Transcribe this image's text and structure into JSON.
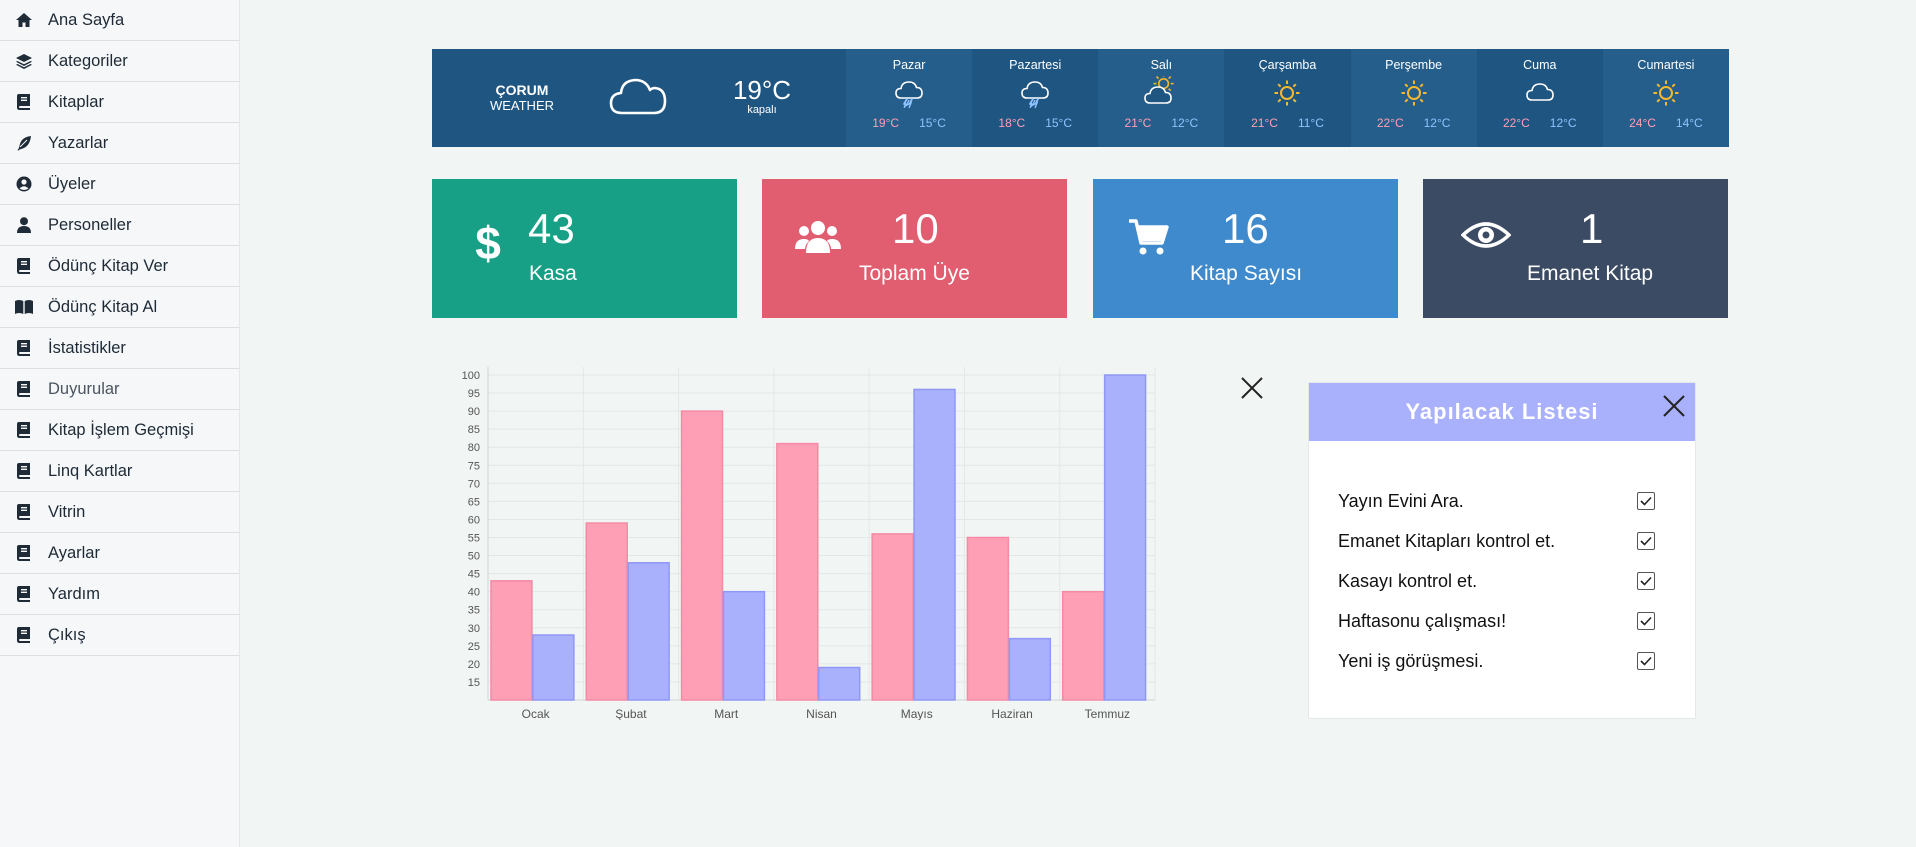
{
  "sidebar": {
    "items": [
      {
        "label": "Ana Sayfa",
        "icon": "home-icon"
      },
      {
        "label": "Kategoriler",
        "icon": "layers-icon"
      },
      {
        "label": "Kitaplar",
        "icon": "book-icon"
      },
      {
        "label": "Yazarlar",
        "icon": "feather-icon"
      },
      {
        "label": "Üyeler",
        "icon": "user-circle-icon"
      },
      {
        "label": "Personeller",
        "icon": "user-icon"
      },
      {
        "label": "Ödünç Kitap Ver",
        "icon": "book-icon"
      },
      {
        "label": "Ödünç Kitap Al",
        "icon": "open-book-icon"
      },
      {
        "label": "İstatistikler",
        "icon": "book-icon"
      },
      {
        "label": "Duyurular",
        "icon": "book-icon"
      },
      {
        "label": "Kitap İşlem Geçmişi",
        "icon": "book-icon"
      },
      {
        "label": "Linq Kartlar",
        "icon": "book-icon"
      },
      {
        "label": "Vitrin",
        "icon": "book-icon"
      },
      {
        "label": "Ayarlar",
        "icon": "book-icon"
      },
      {
        "label": "Yardım",
        "icon": "book-icon"
      },
      {
        "label": "Çıkış",
        "icon": "book-icon"
      }
    ]
  },
  "weather": {
    "city": "ÇORUM",
    "label": "WEATHER",
    "current_temp": "19°C",
    "current_desc": "kapalı",
    "current_icon": "cloud-icon",
    "days": [
      {
        "name": "Pazar",
        "hi": "19°C",
        "lo": "15°C",
        "icon": "rain-icon"
      },
      {
        "name": "Pazartesi",
        "hi": "18°C",
        "lo": "15°C",
        "icon": "rain-icon"
      },
      {
        "name": "Salı",
        "hi": "21°C",
        "lo": "12°C",
        "icon": "partly-sunny-icon"
      },
      {
        "name": "Çarşamba",
        "hi": "21°C",
        "lo": "11°C",
        "icon": "sun-icon"
      },
      {
        "name": "Perşembe",
        "hi": "22°C",
        "lo": "12°C",
        "icon": "sun-icon"
      },
      {
        "name": "Cuma",
        "hi": "22°C",
        "lo": "12°C",
        "icon": "cloud-icon"
      },
      {
        "name": "Cumartesi",
        "hi": "24°C",
        "lo": "14°C",
        "icon": "sun-icon"
      }
    ]
  },
  "cards": [
    {
      "value": "43",
      "label": "Kasa",
      "icon": "dollar-icon",
      "color": "#17a085"
    },
    {
      "value": "10",
      "label": "Toplam Üye",
      "icon": "users-icon",
      "color": "#e15d70"
    },
    {
      "value": "16",
      "label": "Kitap Sayısı",
      "icon": "cart-icon",
      "color": "#3e8acd"
    },
    {
      "value": "1",
      "label": "Emanet Kitap",
      "icon": "eye-icon",
      "color": "#3b4b63"
    }
  ],
  "chart_data": {
    "type": "bar",
    "categories": [
      "Ocak",
      "Şubat",
      "Mart",
      "Nisan",
      "Mayıs",
      "Haziran",
      "Temmuz"
    ],
    "series": [
      {
        "values": [
          43,
          59,
          90,
          81,
          56,
          55,
          40
        ],
        "color": "#ff9fb6"
      },
      {
        "values": [
          28,
          48,
          40,
          19,
          96,
          27,
          100
        ],
        "color": "#a9b0fc"
      }
    ],
    "yticks": [
      15,
      20,
      25,
      30,
      35,
      40,
      45,
      50,
      55,
      60,
      65,
      70,
      75,
      80,
      85,
      90,
      95,
      100
    ],
    "ylim": [
      10,
      100
    ],
    "grid": true,
    "title": "",
    "xlabel": "",
    "ylabel": ""
  },
  "todo": {
    "title": "Yapılacak Listesi",
    "items": [
      "Yayın Evini Ara.",
      "Emanet Kitapları kontrol et.",
      "Kasayı kontrol et.",
      "Haftasonu çalışması!",
      "Yeni iş görüşmesi."
    ]
  }
}
